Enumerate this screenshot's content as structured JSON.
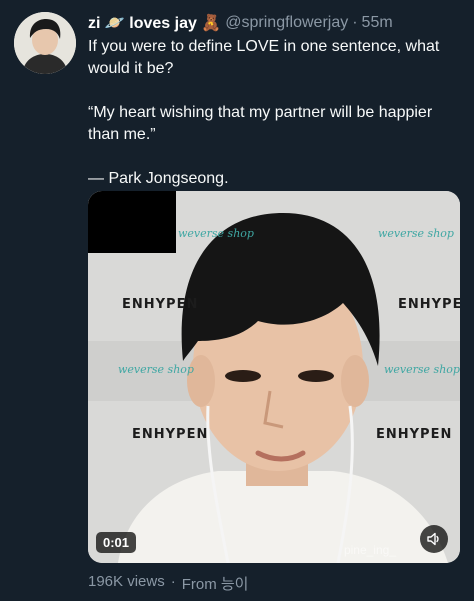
{
  "author": {
    "display_name": "zi",
    "display_name_suffix": "loves jay",
    "emoji_1": "🪐",
    "emoji_2": "🧸",
    "handle": "@springflowerjay",
    "separator": "·",
    "time_ago": "55m"
  },
  "tweet": {
    "line_1": "If you were to define LOVE in one sentence, what would it be?",
    "line_2": "“My heart wishing that my partner will be happier than me.”",
    "line_3": "— Park Jongseong."
  },
  "media": {
    "duration": "0:01",
    "backdrop": {
      "word_1": "ENHYPEN",
      "word_2": "ENHYPEN",
      "word_3": "ENHYPEN",
      "word_4": "ENHYPEN",
      "shop_1": "weverse shop",
      "shop_2": "weverse shop",
      "shop_3": "weverse shop",
      "shop_4": "weverse shop"
    },
    "watermark": "pine_ing_",
    "volume_icon": "speaker-icon"
  },
  "footer": {
    "views": "196K views",
    "separator": "·",
    "source": "From 능이"
  },
  "colors": {
    "background": "#15202b",
    "secondary_text": "#8b98a5",
    "primary_text": "#f7f9f9"
  }
}
